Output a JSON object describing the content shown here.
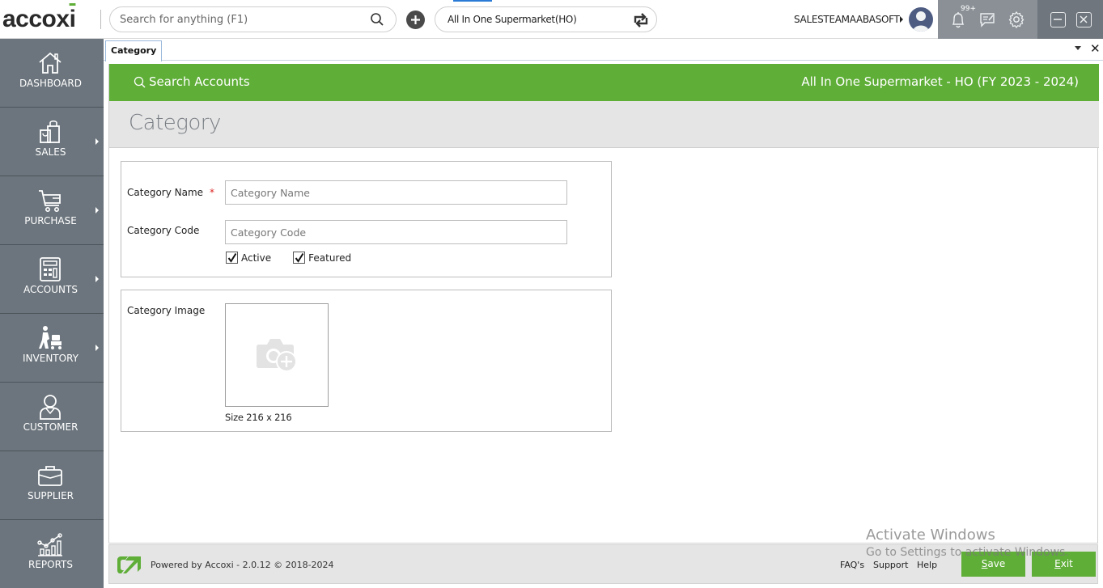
{
  "app": {
    "logo": "accoxi",
    "global_search_placeholder": "Search for anything (F1)",
    "company_selector": "All In One Supermarket(HO)",
    "user_name": "SALESTEAMAABASOFT",
    "notification_count": "99+"
  },
  "sidebar": {
    "items": [
      {
        "label": "DASHBOARD",
        "icon": "home-icon",
        "has_submenu": false
      },
      {
        "label": "SALES",
        "icon": "shopping-bag-icon",
        "has_submenu": true
      },
      {
        "label": "PURCHASE",
        "icon": "cart-icon",
        "has_submenu": true
      },
      {
        "label": "ACCOUNTS",
        "icon": "calculator-icon",
        "has_submenu": true
      },
      {
        "label": "INVENTORY",
        "icon": "trolley-icon",
        "has_submenu": true
      },
      {
        "label": "CUSTOMER",
        "icon": "person-icon",
        "has_submenu": false
      },
      {
        "label": "SUPPLIER",
        "icon": "briefcase-icon",
        "has_submenu": false
      },
      {
        "label": "REPORTS",
        "icon": "chart-icon",
        "has_submenu": false
      }
    ]
  },
  "tabs": [
    {
      "label": "Category",
      "active": true
    }
  ],
  "header_bar": {
    "search_label": "Search Accounts",
    "company_title": "All In One Supermarket - HO (FY 2023 - 2024)"
  },
  "page": {
    "title": "Category"
  },
  "form": {
    "category_name": {
      "label": "Category Name",
      "required_mark": "*",
      "value": "",
      "placeholder": "Category Name"
    },
    "category_code": {
      "label": "Category Code",
      "value": "",
      "placeholder": "Category Code"
    },
    "active": {
      "label": "Active",
      "checked": true
    },
    "featured": {
      "label": "Featured",
      "checked": true
    },
    "category_image": {
      "label": "Category Image",
      "size_note": "Size 216 x 216"
    }
  },
  "footer": {
    "powered_by": "Powered by Accoxi - 2.0.12 © 2018-2024",
    "links": [
      "FAQ's",
      "Support",
      "Help"
    ],
    "save_label": "ave",
    "save_mnemonic": "S",
    "exit_label": "xit",
    "exit_mnemonic": "E"
  },
  "watermark": {
    "line1": "Activate Windows",
    "line2": "Go to Settings to activate Windows."
  },
  "colors": {
    "brand_green": "#5fae38",
    "sidebar_bg": "#6c757d",
    "tools_bg": "#8a9096",
    "window_controls_bg": "#6f767d"
  }
}
